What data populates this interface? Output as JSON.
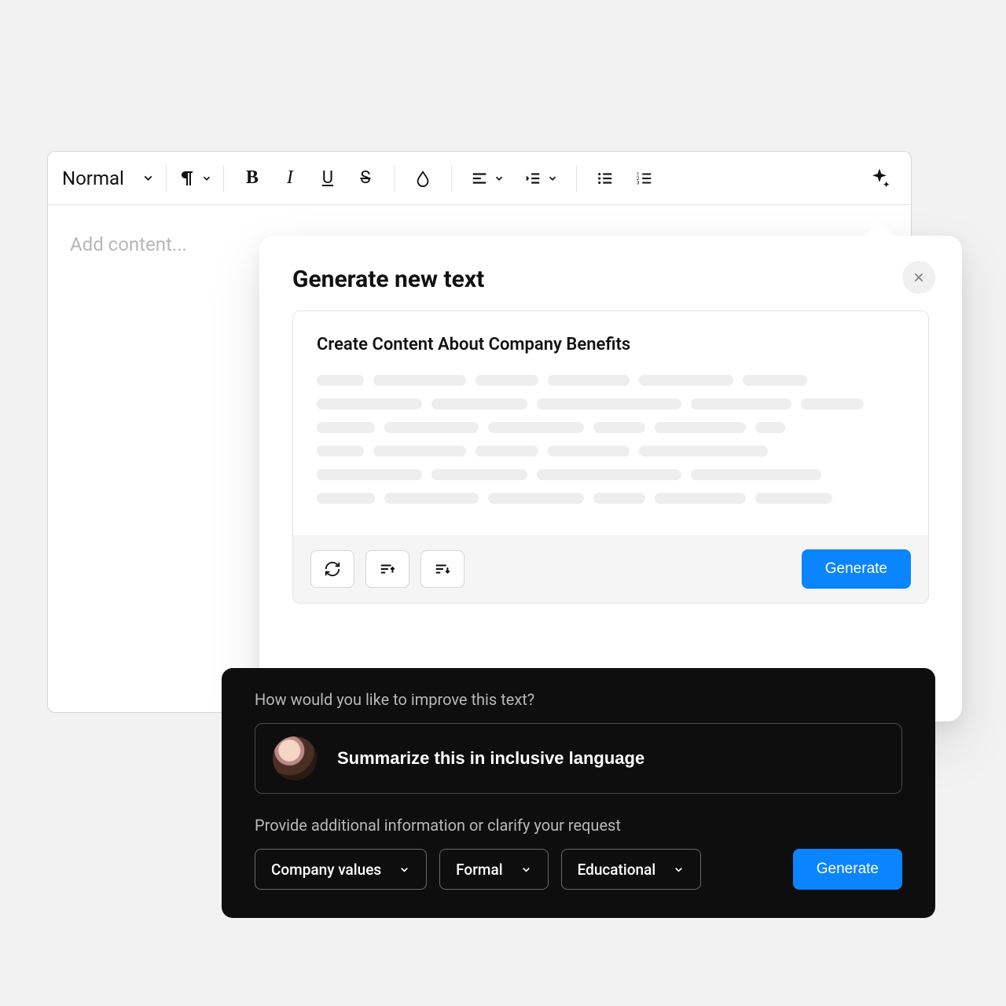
{
  "toolbar": {
    "style_label": "Normal"
  },
  "editor": {
    "placeholder": "Add content..."
  },
  "generate": {
    "title": "Generate new text",
    "prompt": "Create Content About Company Benefits",
    "generate_label": "Generate"
  },
  "improve": {
    "question": "How would you like to improve this text?",
    "input_value": "Summarize this in inclusive language",
    "clarify_label": "Provide additional information or clarify your request",
    "chips": {
      "topic": "Company values",
      "tone": "Formal",
      "style": "Educational"
    },
    "generate_label": "Generate"
  },
  "skeleton": [
    [
      60,
      118,
      80,
      104,
      120,
      82
    ],
    [
      134,
      122,
      184,
      128,
      80
    ],
    [
      74,
      120,
      122,
      66,
      116,
      38
    ],
    [
      60,
      118,
      80,
      104,
      164
    ],
    [
      134,
      122,
      184,
      166
    ],
    [
      74,
      120,
      122,
      66,
      116,
      98
    ]
  ]
}
